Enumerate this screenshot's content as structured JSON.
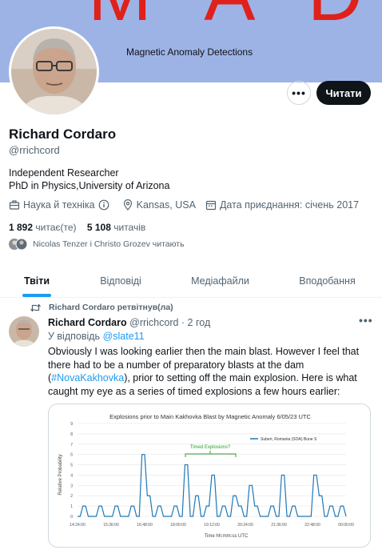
{
  "banner": {
    "title": "M A D",
    "subtitle": "Magnetic Anomaly Detections"
  },
  "actions": {
    "more_label": "•••",
    "follow_label": "Читати"
  },
  "profile": {
    "name": "Richard Cordaro",
    "handle": "@rrichcord",
    "bio_line1": "Independent Researcher",
    "bio_line2": "PhD in Physics,University of Arizona",
    "category": "Наука й техніка",
    "location": "Kansas, USA",
    "joined": "Дата приєднання: січень 2017",
    "following_count": "1 892",
    "following_label": "читає(те)",
    "followers_count": "5 108",
    "followers_label": "читачів",
    "followed_by": "Nicolas Tenzer і Christo Grozev читають"
  },
  "tabs": [
    {
      "label": "Твіти"
    },
    {
      "label": "Відповіді"
    },
    {
      "label": "Медіафайли"
    },
    {
      "label": "Вподобання"
    }
  ],
  "post": {
    "retweet_label": "Richard Cordaro ретвітнув(ла)",
    "author": "Richard Cordaro",
    "handle": "@rrichcord",
    "time": "· 2 год",
    "reply_prefix": "У відповідь",
    "reply_to": "@slate11",
    "text_before": "Obviously I was looking earlier then the main blast.  However I feel that there had to be a number of preparatory blasts at the dam (",
    "hashtag": "#NovaKakhovka",
    "text_after": "), prior to setting off the main explosion.  Here is what caught my eye as a series of timed explosions a few hours earlier:",
    "more_label": "•••"
  },
  "chart_data": {
    "type": "line",
    "title": "Explosions prior to Main Kakhovka Blast by Magnetic Anomaly 6/05/23 UTC",
    "xlabel": "Time hh:mm:ss UTC",
    "ylabel": "Relative Probability",
    "ylim": [
      0,
      9
    ],
    "y_ticks": [
      "0",
      "1",
      "2",
      "3",
      "4",
      "5",
      "6",
      "7",
      "8",
      "9"
    ],
    "x_ticks": [
      "14:24:00",
      "15:36:00",
      "16:48:00",
      "18:00:00",
      "19:12:00",
      "20:24:00",
      "21:36:00",
      "22:48:00",
      "00:00:00"
    ],
    "legend": "Suberi, Romania (SOA) Bune S",
    "annotation": "Timed Explosions?",
    "series": [
      {
        "name": "Suberi, Romania (SOA) Bune S",
        "color": "#1f77b4",
        "x": [
          0.0,
          0.2,
          0.4,
          0.6,
          0.8,
          1.0,
          1.2,
          1.4,
          1.6,
          1.8,
          2.0,
          2.2,
          2.4,
          2.6,
          2.8,
          3.0,
          3.2,
          3.4,
          3.6,
          3.8,
          4.0,
          4.2,
          4.4,
          4.6,
          4.8,
          5.0,
          5.2,
          5.4,
          5.6,
          5.8,
          6.0,
          6.2,
          6.4,
          6.6,
          6.8,
          7.0,
          7.2,
          7.4,
          7.6,
          7.8,
          8.0,
          8.2,
          8.4,
          8.6,
          8.8,
          9.0,
          9.2,
          9.4,
          9.6,
          9.8,
          10.0
        ],
        "values": [
          0,
          1,
          0,
          0,
          1,
          0,
          0,
          1,
          0,
          0,
          1,
          0,
          6,
          2,
          0,
          1,
          0,
          0,
          1,
          0,
          5,
          0,
          2,
          0,
          1,
          4,
          0,
          1,
          0,
          2,
          1,
          0,
          3,
          1,
          0,
          0,
          1,
          0,
          4,
          0,
          1,
          0,
          0,
          0,
          4,
          2,
          0,
          1,
          0,
          1,
          0
        ]
      }
    ]
  }
}
